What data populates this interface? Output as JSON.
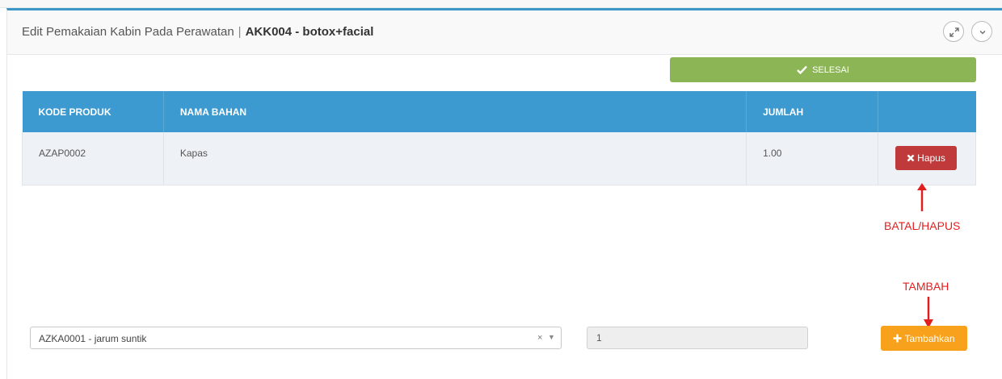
{
  "panel": {
    "title": "Edit Pemakaian Kabin Pada Perawatan",
    "separator": "|",
    "title_bold": "AKK004 - botox+facial"
  },
  "toolbar": {
    "selesai_label": "SELESAI",
    "selesai_icon": "check-icon"
  },
  "table": {
    "headers": [
      "KODE PRODUK",
      "NAMA BAHAN",
      "JUMLAH",
      ""
    ],
    "rows": [
      {
        "kode": "AZAP0002",
        "nama": "Kapas",
        "jumlah": "1.00",
        "action_label": "Hapus"
      }
    ]
  },
  "annotations": {
    "hapus": "BATAL/HAPUS",
    "tambah": "TAMBAH"
  },
  "form": {
    "product_value": "AZKA0001 - jarum suntik",
    "clear_symbol": "×",
    "qty_value": "1",
    "add_label": "Tambahkan"
  },
  "colors": {
    "header_blue": "#3c9ad0",
    "success_green": "#8cb556",
    "danger_red": "#c0393b",
    "warning_orange": "#f7a11c",
    "annotation_red": "#e21f1f"
  }
}
